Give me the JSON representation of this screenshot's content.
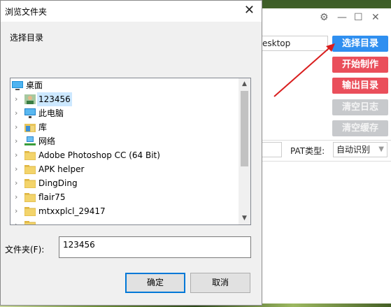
{
  "app": {
    "controls": {
      "settings": "⚙",
      "minimize": "—",
      "maximize": "☐",
      "close": "✕"
    },
    "path_value": "esktop",
    "buttons": {
      "choose_dir": "选择目录",
      "start": "开始制作",
      "output_dir": "输出目录",
      "clear_log": "清空日志",
      "clear_cache": "清空缓存"
    },
    "pat_label": "PAT类型:",
    "pat_value": "自动识别"
  },
  "dialog": {
    "title": "浏览文件夹",
    "instruction": "选择目录",
    "tree": [
      {
        "label": "桌面",
        "icon": "desktop-icon",
        "expandable": false,
        "selected": false
      },
      {
        "label": "123456",
        "icon": "user-icon",
        "expandable": true,
        "selected": true
      },
      {
        "label": "此电脑",
        "icon": "computer-icon",
        "expandable": true,
        "selected": false
      },
      {
        "label": "库",
        "icon": "library-icon",
        "expandable": true,
        "selected": false
      },
      {
        "label": "网络",
        "icon": "network-icon",
        "expandable": true,
        "selected": false
      },
      {
        "label": "Adobe Photoshop CC (64 Bit)",
        "icon": "folder-icon",
        "expandable": true,
        "selected": false
      },
      {
        "label": "APK helper",
        "icon": "folder-icon",
        "expandable": true,
        "selected": false
      },
      {
        "label": "DingDing",
        "icon": "folder-icon",
        "expandable": true,
        "selected": false
      },
      {
        "label": "flair75",
        "icon": "folder-icon",
        "expandable": true,
        "selected": false
      },
      {
        "label": "mtxxplcl_29417",
        "icon": "folder-icon",
        "expandable": true,
        "selected": false
      }
    ],
    "folder_label": "文件夹(F):",
    "folder_value": "123456",
    "ok": "确定",
    "cancel": "取消"
  }
}
